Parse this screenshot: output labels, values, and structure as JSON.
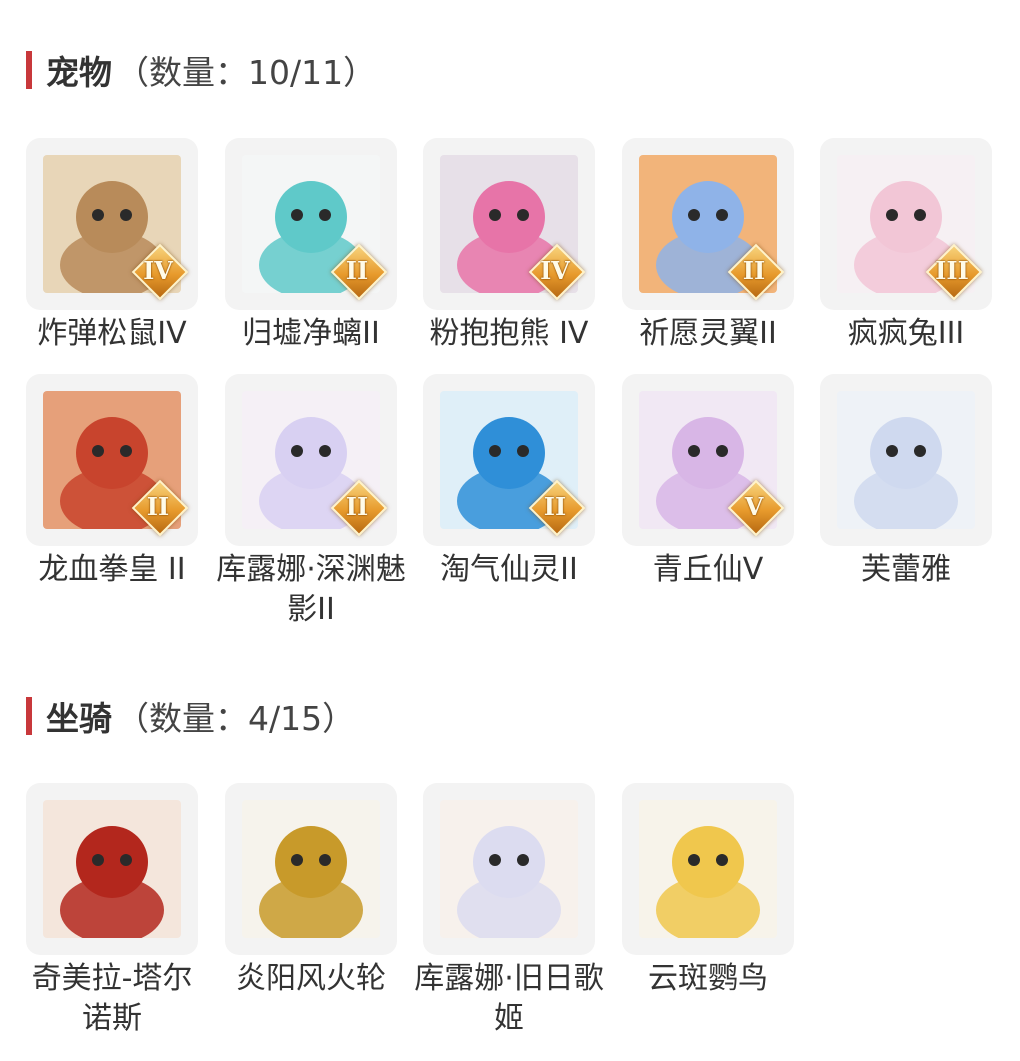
{
  "pets": {
    "title": "宠物",
    "count": "（数量：10/11）",
    "items": [
      {
        "name": "炸弹松鼠IV",
        "level": "IV",
        "icon": "squirrel-icon",
        "bg": "#e8d6b8",
        "fg": "#b88b5a"
      },
      {
        "name": "归墟净螭II",
        "level": "II",
        "icon": "dragon-icon",
        "bg": "#f4f6f6",
        "fg": "#5fc9c9"
      },
      {
        "name": "粉抱抱熊 IV",
        "level": "IV",
        "icon": "bear-icon",
        "bg": "#e7e0e8",
        "fg": "#e774a8"
      },
      {
        "name": "祈愿灵翼II",
        "level": "II",
        "icon": "griffin-icon",
        "bg": "#f2b47a",
        "fg": "#8fb3e8"
      },
      {
        "name": "疯疯兔III",
        "level": "III",
        "icon": "rabbit-icon",
        "bg": "#f6f0f3",
        "fg": "#f2c6d6"
      },
      {
        "name": "龙血拳皇 II",
        "level": "II",
        "icon": "dragon-beast-icon",
        "bg": "#e6a07a",
        "fg": "#c8442d"
      },
      {
        "name": "库露娜·深渊魅影II",
        "level": "II",
        "icon": "girl-icon",
        "bg": "#f5f0f6",
        "fg": "#d8d0f2"
      },
      {
        "name": "淘气仙灵II",
        "level": "II",
        "icon": "puppy-icon",
        "bg": "#dfeff8",
        "fg": "#2f8fd8"
      },
      {
        "name": "青丘仙V",
        "level": "V",
        "icon": "fox-girl-icon",
        "bg": "#f1e8f4",
        "fg": "#d8b6e6"
      },
      {
        "name": "芙蕾雅",
        "level": "",
        "icon": "valkyrie-icon",
        "bg": "#eef2f7",
        "fg": "#cfd9ef"
      }
    ]
  },
  "mounts": {
    "title": "坐骑",
    "count": "（数量：4/15）",
    "items": [
      {
        "name": "奇美拉-塔尔诺斯",
        "level": "",
        "icon": "chimera-icon",
        "bg": "#f4e6dc",
        "fg": "#b3271d"
      },
      {
        "name": "炎阳风火轮",
        "level": "",
        "icon": "fire-wheel-icon",
        "bg": "#f6f3ec",
        "fg": "#c89a2a"
      },
      {
        "name": "库露娜·旧日歌姬",
        "level": "",
        "icon": "singer-girl-icon",
        "bg": "#f7f1ec",
        "fg": "#dcdcf0"
      },
      {
        "name": "云斑鹦鸟",
        "level": "",
        "icon": "parrot-icon",
        "bg": "#f7f3ea",
        "fg": "#f0c74d"
      }
    ]
  }
}
